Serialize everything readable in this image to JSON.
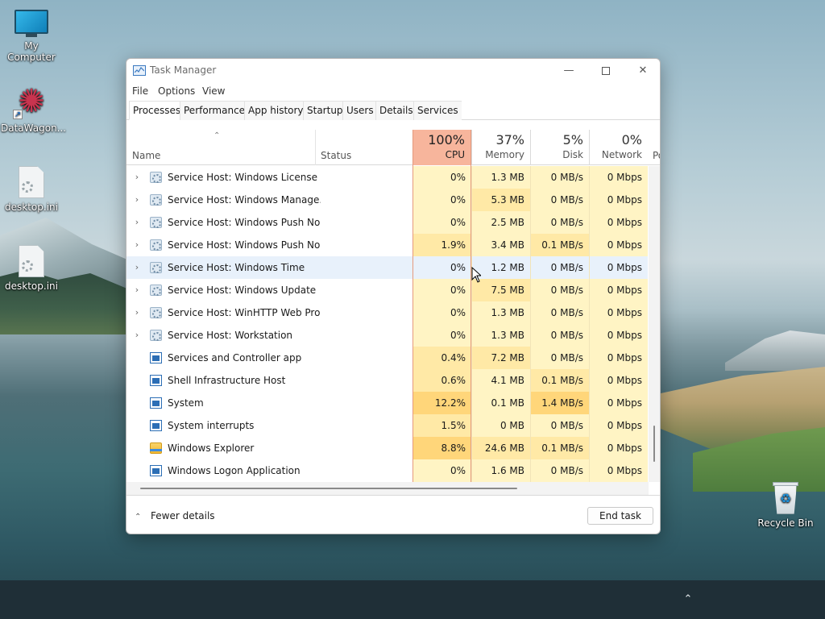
{
  "desktop": {
    "icons": [
      {
        "label": "My Computer"
      },
      {
        "label": "DataWagon..."
      },
      {
        "label": "desktop.ini"
      },
      {
        "label": "desktop.ini"
      },
      {
        "label": "Recycle Bin"
      }
    ]
  },
  "window": {
    "title": "Task Manager",
    "controls": {
      "minimize": "—",
      "close": "✕"
    }
  },
  "menu": [
    "File",
    "Options",
    "View"
  ],
  "tabs": [
    "Processes",
    "Performance",
    "App history",
    "Startup",
    "Users",
    "Details",
    "Services"
  ],
  "active_tab": "Processes",
  "columns": {
    "name": "Name",
    "status": "Status",
    "cpu": {
      "pct": "100%",
      "label": "CPU"
    },
    "memory": {
      "pct": "37%",
      "label": "Memory"
    },
    "disk": {
      "pct": "5%",
      "label": "Disk"
    },
    "network": {
      "pct": "0%",
      "label": "Network"
    },
    "power": "Po"
  },
  "processes": [
    {
      "name": "Service Host: Windows License ...",
      "icon": "gear-icon",
      "expandable": true,
      "cpu": "0%",
      "memory": "1.3 MB",
      "disk": "0 MB/s",
      "network": "0 Mbps"
    },
    {
      "name": "Service Host: Windows Manage...",
      "icon": "gear-icon",
      "expandable": true,
      "cpu": "0%",
      "memory": "5.3 MB",
      "disk": "0 MB/s",
      "network": "0 Mbps"
    },
    {
      "name": "Service Host: Windows Push No...",
      "icon": "gear-icon",
      "expandable": true,
      "cpu": "0%",
      "memory": "2.5 MB",
      "disk": "0 MB/s",
      "network": "0 Mbps"
    },
    {
      "name": "Service Host: Windows Push No...",
      "icon": "gear-icon",
      "expandable": true,
      "cpu": "1.9%",
      "memory": "3.4 MB",
      "disk": "0.1 MB/s",
      "network": "0 Mbps"
    },
    {
      "name": "Service Host: Windows Time",
      "icon": "gear-icon",
      "expandable": true,
      "cpu": "0%",
      "memory": "1.2 MB",
      "disk": "0 MB/s",
      "network": "0 Mbps",
      "hover": true
    },
    {
      "name": "Service Host: Windows Update",
      "icon": "gear-icon",
      "expandable": true,
      "cpu": "0%",
      "memory": "7.5 MB",
      "disk": "0 MB/s",
      "network": "0 Mbps"
    },
    {
      "name": "Service Host: WinHTTP Web Pro...",
      "icon": "gear-icon",
      "expandable": true,
      "cpu": "0%",
      "memory": "1.3 MB",
      "disk": "0 MB/s",
      "network": "0 Mbps"
    },
    {
      "name": "Service Host: Workstation",
      "icon": "gear-icon",
      "expandable": true,
      "cpu": "0%",
      "memory": "1.3 MB",
      "disk": "0 MB/s",
      "network": "0 Mbps"
    },
    {
      "name": "Services and Controller app",
      "icon": "window-icon",
      "expandable": false,
      "cpu": "0.4%",
      "memory": "7.2 MB",
      "disk": "0 MB/s",
      "network": "0 Mbps"
    },
    {
      "name": "Shell Infrastructure Host",
      "icon": "window-icon",
      "expandable": false,
      "cpu": "0.6%",
      "memory": "4.1 MB",
      "disk": "0.1 MB/s",
      "network": "0 Mbps"
    },
    {
      "name": "System",
      "icon": "window-icon",
      "expandable": false,
      "cpu": "12.2%",
      "memory": "0.1 MB",
      "disk": "1.4 MB/s",
      "network": "0 Mbps"
    },
    {
      "name": "System interrupts",
      "icon": "window-icon",
      "expandable": false,
      "cpu": "1.5%",
      "memory": "0 MB",
      "disk": "0 MB/s",
      "network": "0 Mbps"
    },
    {
      "name": "Windows Explorer",
      "icon": "folder-icon",
      "expandable": false,
      "cpu": "8.8%",
      "memory": "24.6 MB",
      "disk": "0.1 MB/s",
      "network": "0 Mbps"
    },
    {
      "name": "Windows Logon Application",
      "icon": "window-icon",
      "expandable": false,
      "cpu": "0%",
      "memory": "1.6 MB",
      "disk": "0 MB/s",
      "network": "0 Mbps"
    }
  ],
  "footer": {
    "fewer_details": "Fewer details",
    "end_task": "End task"
  },
  "colors": {
    "cpu_header": "#f7b59c",
    "heat_low": "#fff4c4",
    "heat_mid": "#ffe9a6",
    "heat_high": "#ffd67a",
    "hover_row": "#e8f1fb"
  }
}
